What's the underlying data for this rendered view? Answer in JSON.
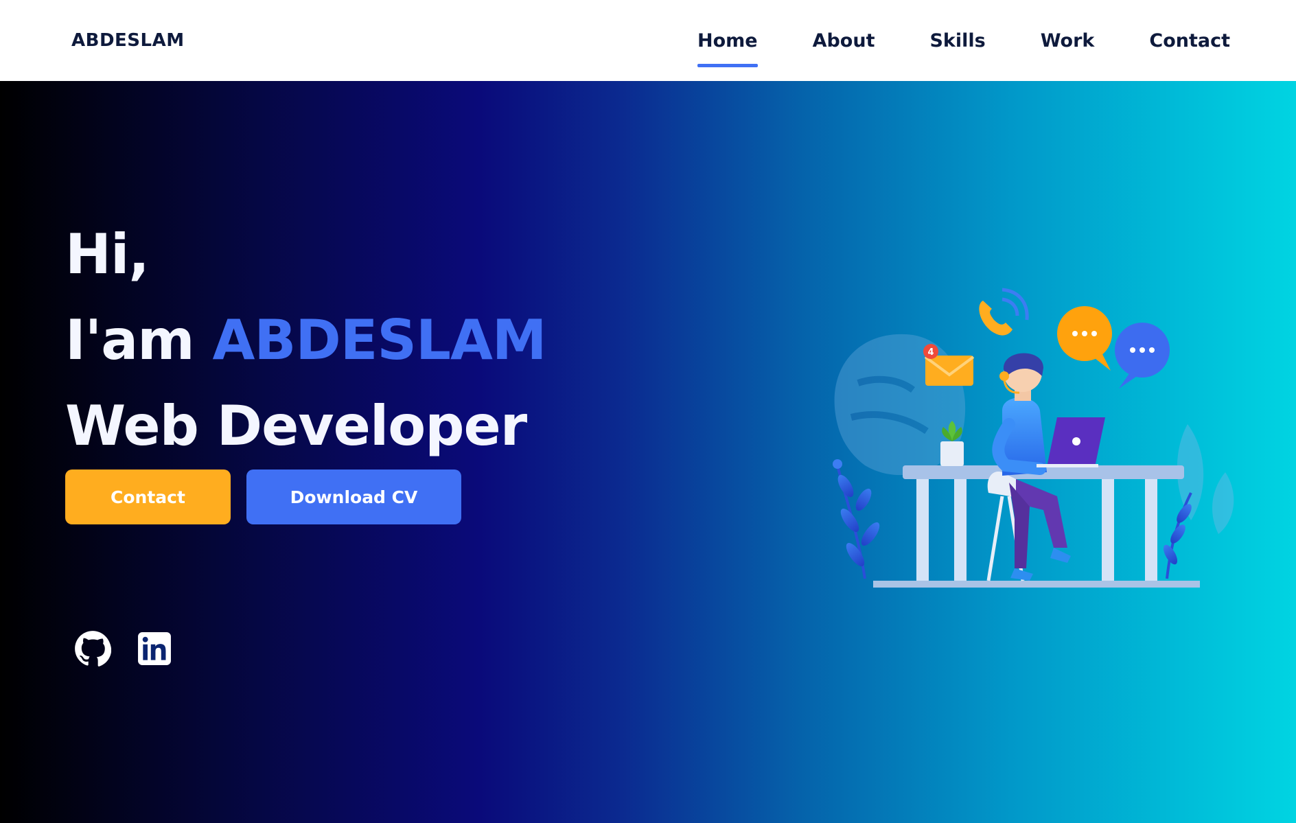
{
  "header": {
    "logo": "ABDESLAM",
    "nav": [
      {
        "label": "Home",
        "active": true
      },
      {
        "label": "About",
        "active": false
      },
      {
        "label": "Skills",
        "active": false
      },
      {
        "label": "Work",
        "active": false
      },
      {
        "label": "Contact",
        "active": false
      }
    ]
  },
  "hero": {
    "line1": "Hi,",
    "line2_prefix": "I'am ",
    "line2_name": "ABDESLAM",
    "line3": "Web Developer",
    "buttons": {
      "contact": "Contact",
      "download_cv": "Download CV"
    },
    "socials": [
      {
        "icon": "github-icon"
      },
      {
        "icon": "linkedin-icon"
      }
    ]
  },
  "colors": {
    "accent": "#4070f4",
    "contact_button": "#ffad1f",
    "text_dark": "#0e1a3c",
    "text_light": "#f4f6ff"
  }
}
